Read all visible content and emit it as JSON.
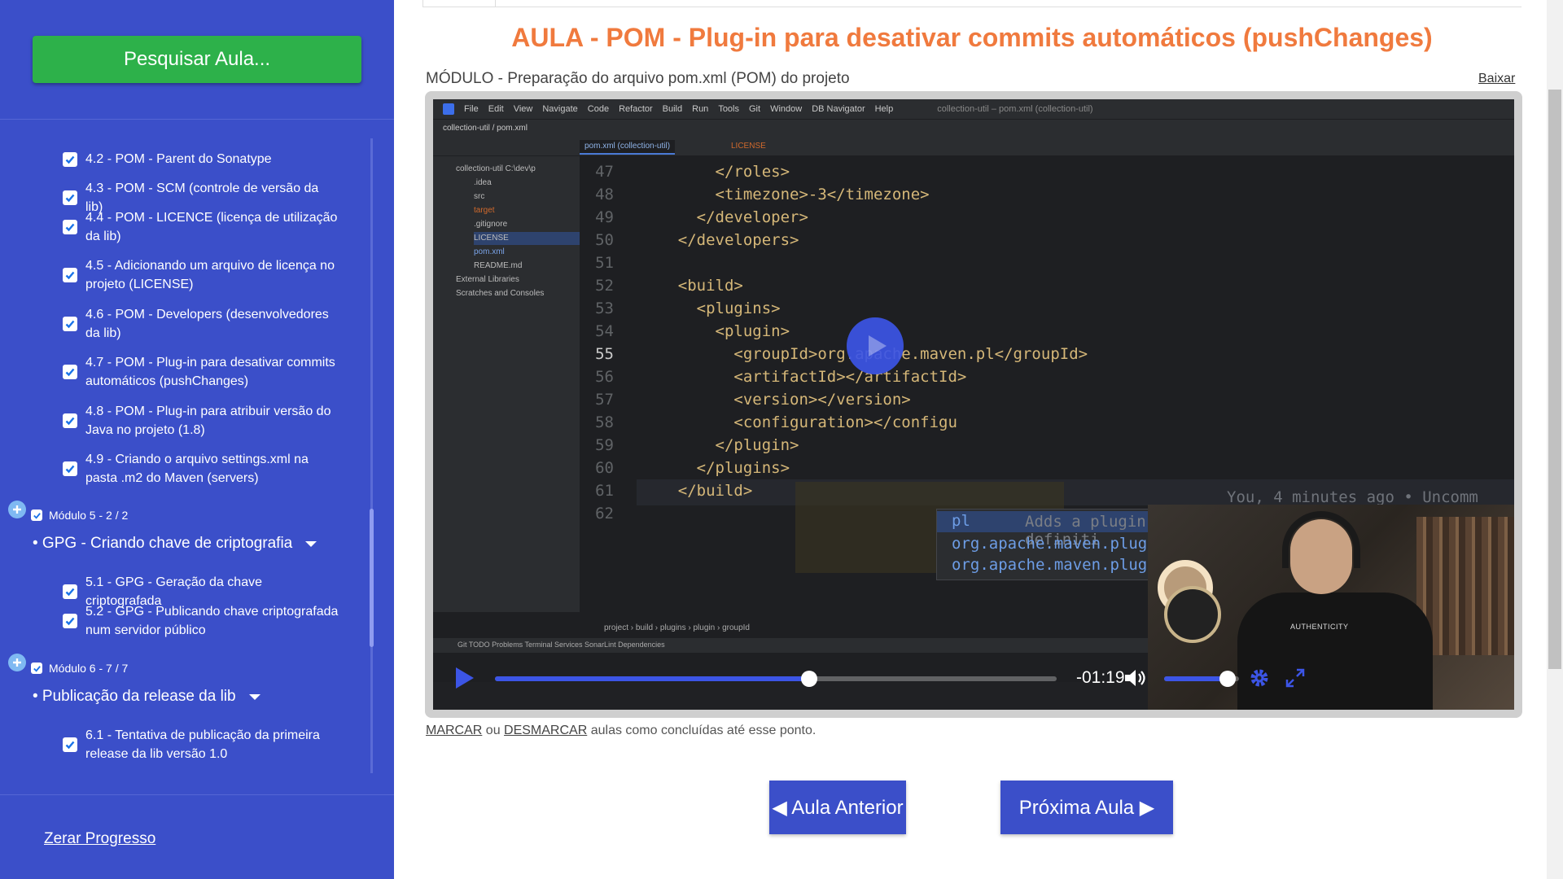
{
  "sidebar": {
    "search_label": "Pesquisar Aula...",
    "lessons_a": [
      "4.2 - POM - Parent do Sonatype",
      "4.3 - POM - SCM (controle de versão da lib)",
      "4.4 - POM - LICENCE (licença de utilização da lib)",
      "4.5 - Adicionando um arquivo de licença no projeto (LICENSE)",
      "4.6 - POM - Developers (desenvolvedores da lib)",
      "4.7 - POM - Plug-in para desativar commits automáticos (pushChanges)",
      "4.8 - POM - Plug-in para atribuir versão do Java no projeto (1.8)",
      "4.9 - Criando o arquivo settings.xml na pasta .m2 do Maven (servers)"
    ],
    "module5": "Módulo 5 - 2 / 2",
    "section5": "• GPG - Criando chave de criptografia",
    "lessons_b": [
      "5.1 - GPG - Geração da chave criptografada",
      "5.2 - GPG - Publicando chave criptografada num servidor público"
    ],
    "module6": "Módulo 6 - 7 / 7",
    "section6": "• Publicação da release da lib",
    "lessons_c": [
      "6.1 - Tentativa de publicação da primeira release da lib versão 1.0"
    ],
    "reset_label": "Zerar Progresso"
  },
  "main": {
    "title": "AULA - POM - Plug-in para desativar commits automáticos (pushChanges)",
    "module_line": "MÓDULO - Preparação do arquivo pom.xml (POM) do projeto",
    "download_label": "Baixar",
    "mark_label": "MARCAR",
    "or_label": " ou ",
    "unmark_label": "DESMARCAR",
    "mark_suffix": " aulas como concluídas até esse ponto.",
    "prev_label": "◀ Aula Anterior",
    "next_label": "Próxima Aula ▶"
  },
  "video": {
    "time_remaining": "-01:19",
    "progress": 0.56,
    "volume": 0.85,
    "ide": {
      "menu": [
        "File",
        "Edit",
        "View",
        "Navigate",
        "Code",
        "Refactor",
        "Build",
        "Run",
        "Tools",
        "Git",
        "Window",
        "DB Navigator",
        "Help"
      ],
      "window_title": "collection-util – pom.xml (collection-util)",
      "project_path": "collection-util  /  pom.xml",
      "tab1": "pom.xml (collection-util)",
      "tab2": "LICENSE",
      "tree": [
        "collection-util  C:\\dev\\p",
        ".idea",
        "src",
        "target",
        ".gitignore",
        "LICENSE",
        "pom.xml",
        "README.md",
        "External Libraries",
        "Scratches and Consoles"
      ],
      "line_numbers": [
        "47",
        "48",
        "49",
        "50",
        "51",
        "52",
        "53",
        "54",
        "55",
        "56",
        "57",
        "58",
        "59",
        "60",
        "61",
        "62"
      ],
      "code_lines": [
        "        </roles>",
        "        <timezone>-3</timezone>",
        "      </developer>",
        "    </developers>",
        "",
        "    <build>",
        "      <plugins>",
        "        <plugin>",
        "          <groupId>org.apache.maven.pl</groupId>",
        "          <artifactId></artifactId>",
        "          <version></version>",
        "          <configuration></configu",
        "        </plugin>",
        "      </plugins>",
        "    </build>",
        ""
      ],
      "blame": "You, 4 minutes ago • Uncomm",
      "popup": [
        "pl",
        "org.apache.maven.plugin-tools",
        "org.apache.maven.plugins"
      ],
      "popup_hint": "Adds a plugin definiti",
      "breadcrumb": "project  ›  build  ›  plugins  ›  plugin  ›  groupId",
      "status": "Git    TODO    Problems    Terminal    Services    SonarLint    Dependencies"
    },
    "webcam_shirt": "AUTHENTICITY"
  }
}
